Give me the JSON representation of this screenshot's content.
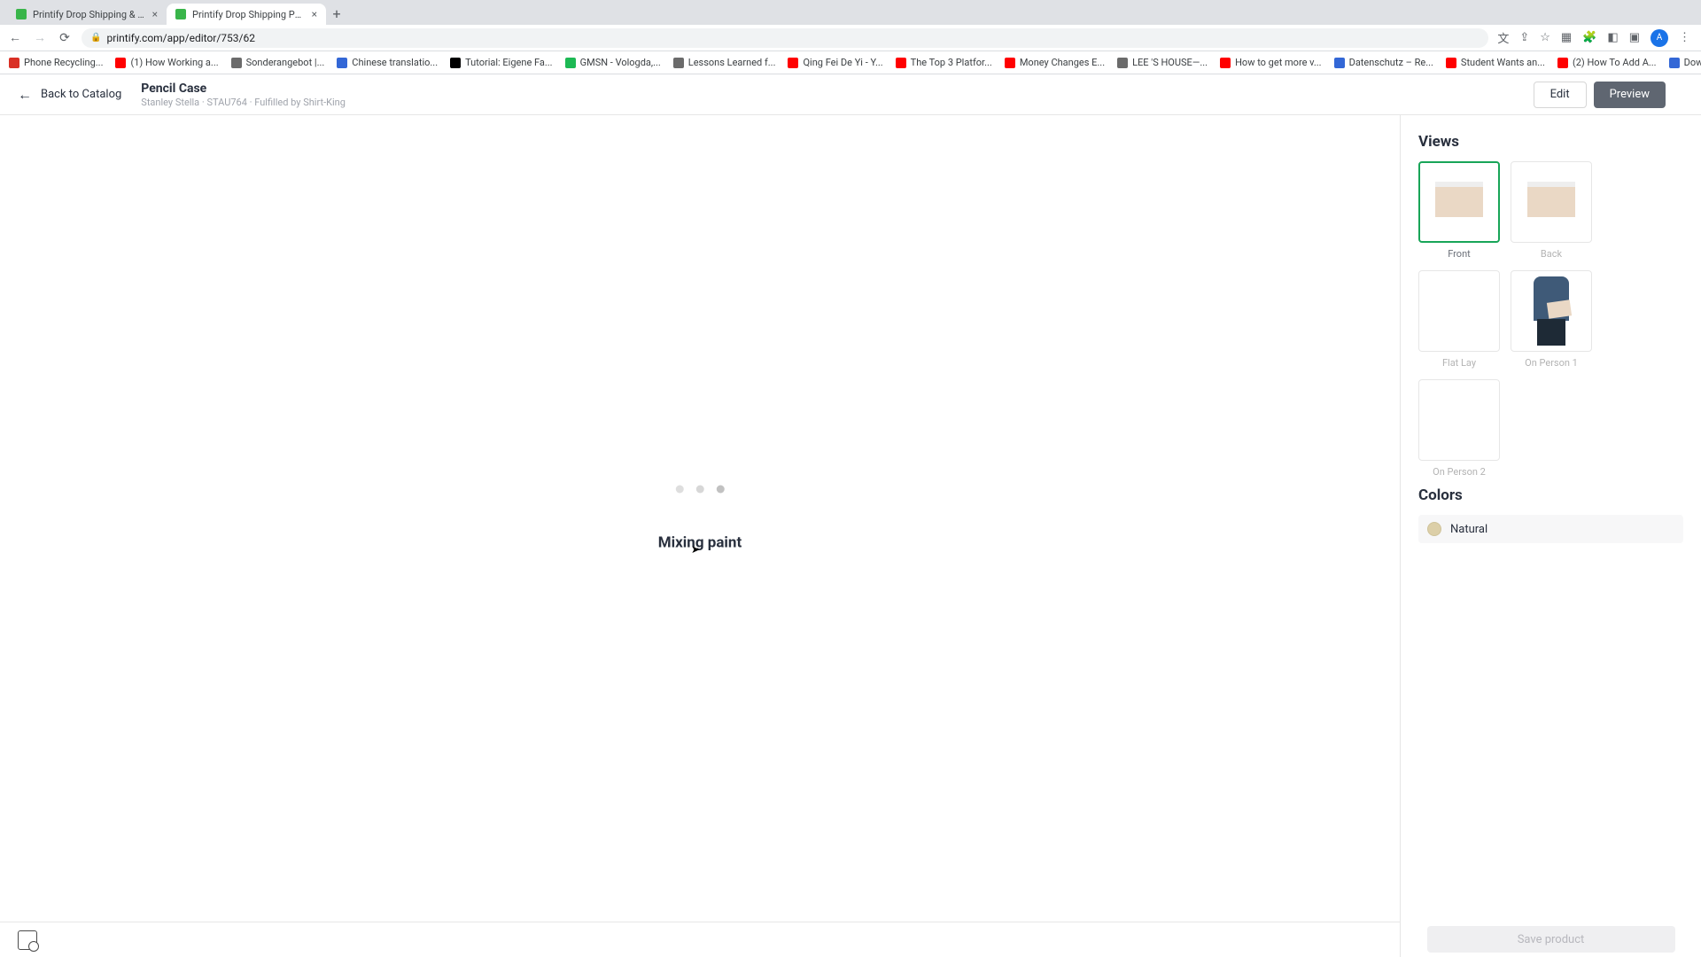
{
  "browser": {
    "tabs": [
      {
        "title": "Printify Drop Shipping & Printi",
        "active": false
      },
      {
        "title": "Printify Drop Shipping Print o",
        "active": true
      }
    ],
    "url": "printify.com/app/editor/753/62",
    "bookmarks": [
      {
        "label": "Phone Recycling...",
        "color": "#d93025"
      },
      {
        "label": "(1) How Working a...",
        "color": "#ff0000"
      },
      {
        "label": "Sonderangebot |...",
        "color": "#6b6b6b"
      },
      {
        "label": "Chinese translatio...",
        "color": "#3367d6"
      },
      {
        "label": "Tutorial: Eigene Fa...",
        "color": "#000"
      },
      {
        "label": "GMSN - Vologda,...",
        "color": "#1db954"
      },
      {
        "label": "Lessons Learned f...",
        "color": "#6b6b6b"
      },
      {
        "label": "Qing Fei De Yi - Y...",
        "color": "#ff0000"
      },
      {
        "label": "The Top 3 Platfor...",
        "color": "#ff0000"
      },
      {
        "label": "Money Changes E...",
        "color": "#ff0000"
      },
      {
        "label": "LEE 'S HOUSE—...",
        "color": "#6b6b6b"
      },
      {
        "label": "How to get more v...",
        "color": "#ff0000"
      },
      {
        "label": "Datenschutz – Re...",
        "color": "#3367d6"
      },
      {
        "label": "Student Wants an...",
        "color": "#ff0000"
      },
      {
        "label": "(2) How To Add A...",
        "color": "#ff0000"
      },
      {
        "label": "Download - Cooki...",
        "color": "#3367d6"
      }
    ]
  },
  "header": {
    "back_label": "Back to Catalog",
    "product_title": "Pencil Case",
    "product_sub": "Stanley Stella · STAU764 · Fulfilled by Shirt-King",
    "edit_label": "Edit",
    "preview_label": "Preview"
  },
  "canvas": {
    "loading_text": "Mixing paint"
  },
  "side": {
    "views_heading": "Views",
    "views": [
      {
        "label": "Front",
        "kind": "case",
        "selected": true,
        "dim": false
      },
      {
        "label": "Back",
        "kind": "case",
        "selected": false,
        "dim": true
      },
      {
        "label": "Flat Lay",
        "kind": "empty",
        "selected": false,
        "dim": true
      },
      {
        "label": "On Person 1",
        "kind": "person",
        "selected": false,
        "dim": true
      },
      {
        "label": "On Person 2",
        "kind": "empty",
        "selected": false,
        "dim": true
      }
    ],
    "colors_heading": "Colors",
    "color_name": "Natural",
    "color_hex": "#dccfa8"
  },
  "footer": {
    "save_label": "Save product"
  }
}
